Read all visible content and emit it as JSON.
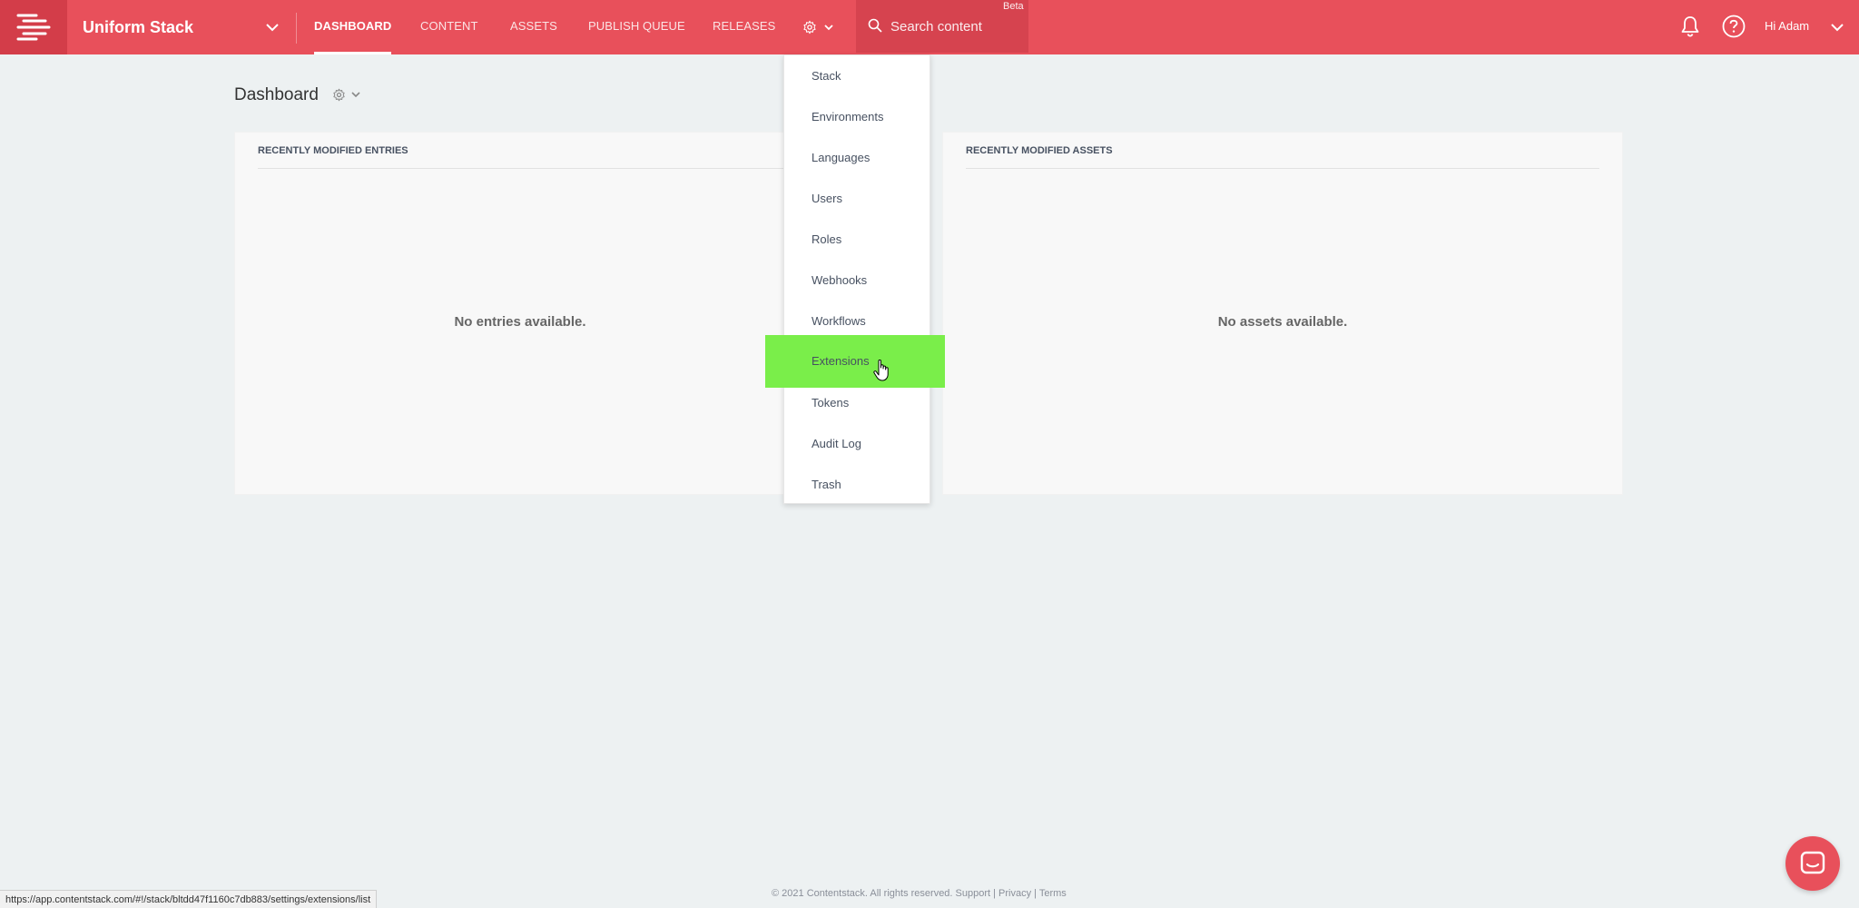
{
  "header": {
    "stack_name": "Uniform Stack",
    "nav": [
      {
        "label": "DASHBOARD",
        "active": true
      },
      {
        "label": "CONTENT",
        "active": false
      },
      {
        "label": "ASSETS",
        "active": false
      },
      {
        "label": "PUBLISH QUEUE",
        "active": false
      },
      {
        "label": "RELEASES",
        "active": false
      }
    ],
    "search_placeholder": "Search content",
    "beta_badge": "Beta",
    "user_greeting": "Hi  Adam",
    "accent_color": "#e8505b"
  },
  "dashboard": {
    "title": "Dashboard",
    "entries_panel": {
      "title": "RECENTLY MODIFIED ENTRIES",
      "empty_text": "No entries available."
    },
    "assets_panel": {
      "title": "RECENTLY MODIFIED ASSETS",
      "empty_text": "No assets available."
    }
  },
  "settings_menu": {
    "items": [
      "Stack",
      "Environments",
      "Languages",
      "Users",
      "Roles",
      "Webhooks",
      "Workflows",
      "Extensions",
      "Tokens",
      "Audit Log",
      "Trash"
    ],
    "hovered": "Extensions",
    "highlight_color": "#7aee4a"
  },
  "footer": {
    "copyright": "© 2021 Contentstack. All rights reserved. Support | Privacy | Terms"
  },
  "status_bar": {
    "url": "https://app.contentstack.com/#!/stack/bltdd47f1160c7db883/settings/extensions/list"
  }
}
